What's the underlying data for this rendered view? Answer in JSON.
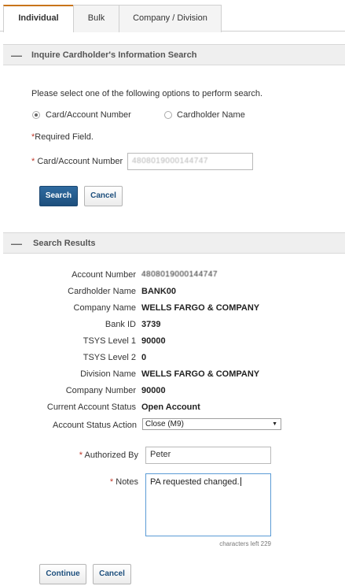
{
  "tabs": [
    {
      "label": "Individual",
      "active": true
    },
    {
      "label": "Bulk",
      "active": false
    },
    {
      "label": "Company / Division",
      "active": false
    }
  ],
  "search_section": {
    "title": "Inquire Cardholder's Information Search",
    "instruction": "Please select one of the following options to perform search.",
    "options": [
      {
        "label": "Card/Account Number",
        "selected": true
      },
      {
        "label": "Cardholder Name",
        "selected": false
      }
    ],
    "required_note": "Required Field.",
    "required_mark": "*",
    "field_label": "Card/Account Number",
    "field_value": "4808019000144747",
    "search_button": "Search",
    "cancel_button": "Cancel"
  },
  "results_section": {
    "title": "Search Results",
    "rows": [
      {
        "label": "Account Number",
        "value": "4808019000144747",
        "masked": true
      },
      {
        "label": "Cardholder Name",
        "value": "BANK00"
      },
      {
        "label": "Company Name",
        "value": "WELLS FARGO & COMPANY"
      },
      {
        "label": "Bank ID",
        "value": "3739"
      },
      {
        "label": "TSYS Level 1",
        "value": "90000"
      },
      {
        "label": "TSYS Level 2",
        "value": "0"
      },
      {
        "label": "Division Name",
        "value": "WELLS FARGO & COMPANY"
      },
      {
        "label": "Company Number",
        "value": "90000"
      },
      {
        "label": "Current Account Status",
        "value": "Open Account"
      }
    ],
    "status_action_label": "Account Status Action",
    "status_action_value": "Close (M9)",
    "authorized_by_label": "Authorized By",
    "authorized_by_value": "Peter",
    "notes_label": "Notes",
    "notes_value": "PA requested changed.",
    "chars_left": "characters left 229",
    "continue_button": "Continue",
    "cancel_button": "Cancel"
  },
  "icons": {
    "collapse": "minus-icon",
    "dropdown": "caret-down-icon"
  },
  "colors": {
    "primary_button": "#1d4f7d",
    "active_tab_accent": "#c8741a",
    "required": "#c0392b",
    "focus_border": "#5b9bd5"
  }
}
